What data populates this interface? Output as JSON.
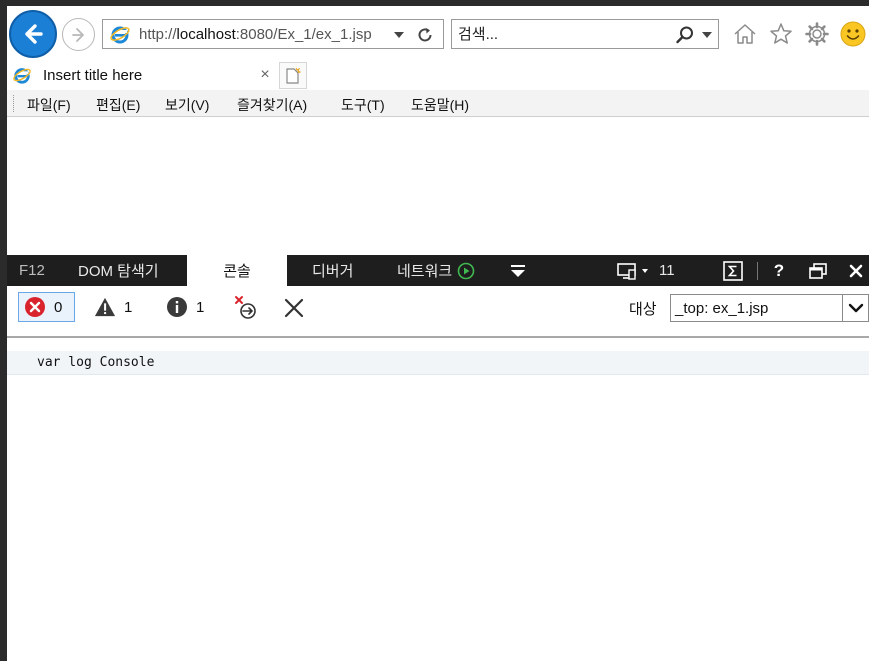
{
  "browser": {
    "address_bar": {
      "url_prefix": "http://",
      "url_host": "localhost",
      "url_rest": ":8080/Ex_1/ex_1.jsp"
    },
    "search": {
      "placeholder": "검색..."
    }
  },
  "tab": {
    "title": "Insert title here",
    "close_glyph": "×"
  },
  "menu": {
    "items": [
      "파일(F)",
      "편집(E)",
      "보기(V)",
      "즐겨찾기(A)",
      "도구(T)",
      "도움말(H)"
    ]
  },
  "devtools": {
    "tabs": {
      "f12": "F12",
      "dom": "DOM 탐색기",
      "console": "콘솔",
      "debugger": "디버거",
      "network": "네트워크"
    },
    "emulation_count": "11",
    "filters": {
      "errors": "0",
      "warnings": "1",
      "info": "1"
    },
    "target": {
      "label": "대상",
      "value": "_top: ex_1.jsp"
    },
    "console_lines": [
      "var log Console"
    ]
  },
  "colors": {
    "accent": "#1b7fd6",
    "devtools_bar": "#1e1e1e",
    "error_red": "#d9242d",
    "network_green": "#3fb950"
  }
}
